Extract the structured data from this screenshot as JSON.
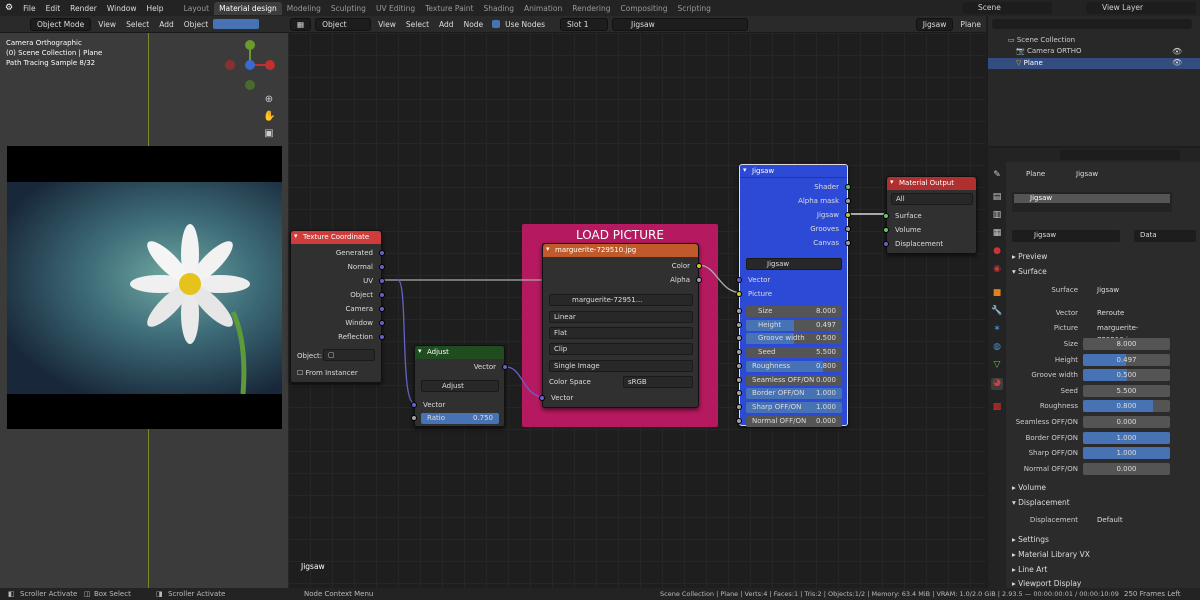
{
  "menu": [
    "File",
    "Edit",
    "Render",
    "Window",
    "Help"
  ],
  "workspaces": [
    "Layout",
    "Material design",
    "Modeling",
    "Sculpting",
    "UV Editing",
    "Texture Paint",
    "Shading",
    "Animation",
    "Rendering",
    "Compositing",
    "Scripting"
  ],
  "active_workspace": "Material design",
  "scene": "Scene",
  "view_layer": "View Layer",
  "vp_header": {
    "mode": "Object Mode",
    "items": [
      "View",
      "Select",
      "Add",
      "Object"
    ]
  },
  "vp_overlay": [
    "Camera Orthographic",
    "(0) Scene Collection | Plane",
    "Path Tracing Sample 8/32"
  ],
  "ne_header": {
    "type": "Object",
    "items": [
      "View",
      "Select",
      "Add",
      "Node"
    ],
    "use_nodes": "Use Nodes",
    "slot": "Slot 1",
    "material": "Jigsaw",
    "right_mat": "Jigsaw",
    "object": "Plane"
  },
  "node_editor_label": "Jigsaw",
  "frame_label": "LOAD PICTURE",
  "texcoord": {
    "title": "Texture Coordinate",
    "outputs": [
      "Generated",
      "Normal",
      "UV",
      "Object",
      "Camera",
      "Window",
      "Reflection"
    ],
    "object_label": "Object:",
    "from_instancer": "From Instancer"
  },
  "adjust": {
    "title": "Adjust",
    "out": "Vector",
    "group": "Adjust",
    "in": "Vector",
    "ratio_label": "Ratio",
    "ratio": "0.750"
  },
  "image": {
    "title": "marguerite-729510.jpg",
    "outputs": [
      "Color",
      "Alpha"
    ],
    "file": "marguerite-72951...",
    "interp": "Linear",
    "proj": "Flat",
    "ext": "Clip",
    "source": "Single Image",
    "cs_label": "Color Space",
    "cs": "sRGB",
    "in": "Vector"
  },
  "jigsaw": {
    "title": "Jigsaw",
    "outputs": [
      "Shader",
      "Alpha mask",
      "Jigsaw",
      "Grooves",
      "Canvas"
    ],
    "group": "Jigsaw",
    "inputs": [
      "Vector",
      "Picture"
    ],
    "fields": [
      {
        "l": "Size",
        "v": "8.000"
      },
      {
        "l": "Height",
        "v": "0.497"
      },
      {
        "l": "Groove width",
        "v": "0.500"
      },
      {
        "l": "Seed",
        "v": "5.500"
      },
      {
        "l": "Roughness",
        "v": "0.800"
      },
      {
        "l": "Seamless OFF/ON",
        "v": "0.000"
      },
      {
        "l": "Border OFF/ON",
        "v": "1.000"
      },
      {
        "l": "Sharp OFF/ON",
        "v": "1.000"
      },
      {
        "l": "Normal OFF/ON",
        "v": "0.000"
      }
    ]
  },
  "matout": {
    "title": "Material Output",
    "target": "All",
    "inputs": [
      "Surface",
      "Volume",
      "Displacement"
    ]
  },
  "outliner": {
    "root": "Scene Collection",
    "items": [
      "Camera ORTHO",
      "Plane"
    ]
  },
  "props": {
    "obj": "Plane",
    "mat": "Jigsaw",
    "slot_name": "Jigsaw",
    "mat_field": "Jigsaw",
    "data": "Data",
    "preview": "Preview",
    "surface_sec": "Surface",
    "surface_label": "Surface",
    "surface_val": "Jigsaw",
    "vector_label": "Vector",
    "vector_val": "Reroute",
    "picture_label": "Picture",
    "picture_val": "marguerite-729510.jpg",
    "fields": [
      {
        "l": "Size",
        "v": "8.000",
        "f": 0
      },
      {
        "l": "Height",
        "v": "0.497",
        "f": 0.497
      },
      {
        "l": "Groove width",
        "v": "0.500",
        "f": 0.5
      },
      {
        "l": "Seed",
        "v": "5.500",
        "f": 0
      },
      {
        "l": "Roughness",
        "v": "0.800",
        "f": 0.8
      },
      {
        "l": "Seamless OFF/ON",
        "v": "0.000",
        "f": 0
      },
      {
        "l": "Border OFF/ON",
        "v": "1.000",
        "f": 1
      },
      {
        "l": "Sharp OFF/ON",
        "v": "1.000",
        "f": 1
      },
      {
        "l": "Normal OFF/ON",
        "v": "0.000",
        "f": 0
      }
    ],
    "volume": "Volume",
    "displacement_sec": "Displacement",
    "disp_label": "Displacement",
    "disp_val": "Default",
    "settings": "Settings",
    "mlvx": "Material Library VX",
    "lineart": "Line Art",
    "vpdisp": "Viewport Display"
  },
  "status": {
    "left": "Scroller Activate",
    "mid1": "Box Select",
    "mid2": "Scroller Activate",
    "ctx": "Node Context Menu",
    "info": "Scene Collection | Plane | Verts:4 | Faces:1 | Tris:2 | Objects:1/2 | Memory: 63.4 MiB | VRAM: 1.0/2.0 GiB | 2.93.5 — 00:00:00:01 / 00:00:10:09",
    "frames": "250 Frames Left"
  },
  "colors": {
    "frame": "#b5195f",
    "texcoord": "#d03c3c",
    "adjust": "#1f4d1f",
    "image": "#c05a2a",
    "jigsaw": "#2c4ad6",
    "matout": "#b12f2f"
  }
}
